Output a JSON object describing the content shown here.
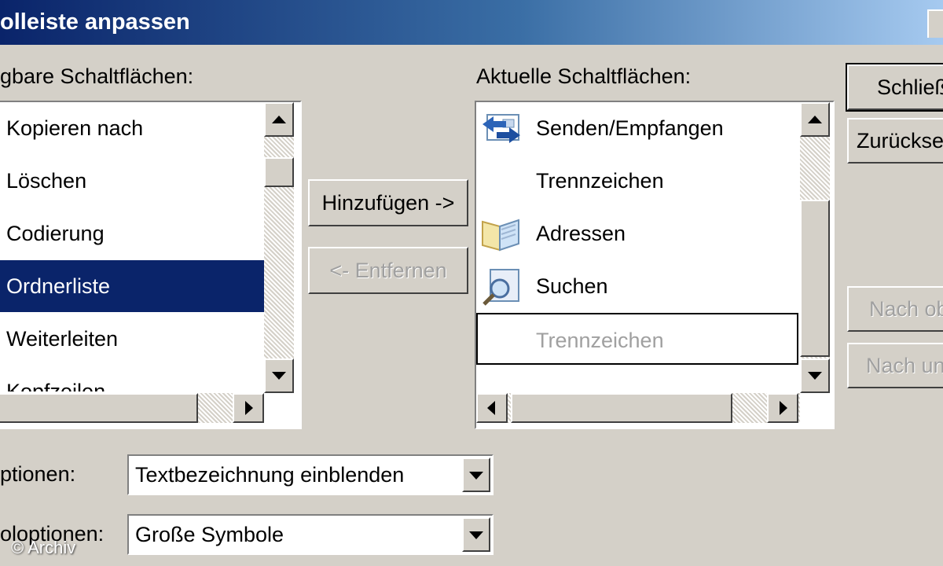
{
  "window": {
    "title": "olleiste anpassen"
  },
  "left_panel": {
    "label": "gbare Schaltflächen:",
    "items": [
      {
        "label": "Kopieren nach"
      },
      {
        "label": "Löschen"
      },
      {
        "label": "Codierung"
      },
      {
        "label": "Ordnerliste",
        "selected": true
      },
      {
        "label": "Weiterleiten"
      },
      {
        "label": "Kopfzeilen"
      }
    ]
  },
  "right_panel": {
    "label": "Aktuelle Schaltflächen:",
    "items": [
      {
        "label": "Senden/Empfangen",
        "icon": "send-receive-icon"
      },
      {
        "label": "Trennzeichen"
      },
      {
        "label": "Adressen",
        "icon": "address-book-icon"
      },
      {
        "label": "Suchen",
        "icon": "search-icon"
      },
      {
        "label": "Trennzeichen",
        "focused": true,
        "disabled": true
      }
    ]
  },
  "buttons": {
    "add": "Hinzufügen ->",
    "remove": "<- Entfernen",
    "close": "Schließ",
    "reset": "Zurückse",
    "move_up": "Nach ob",
    "move_down": "Nach un"
  },
  "options": {
    "text_label": "ptionen:",
    "text_value": "Textbezeichnung einblenden",
    "icon_label": "oloptionen:",
    "icon_value": "Große Symbole"
  },
  "watermark": "© Archiv",
  "colors": {
    "selection": "#0a246a",
    "face": "#d4d0c8"
  }
}
